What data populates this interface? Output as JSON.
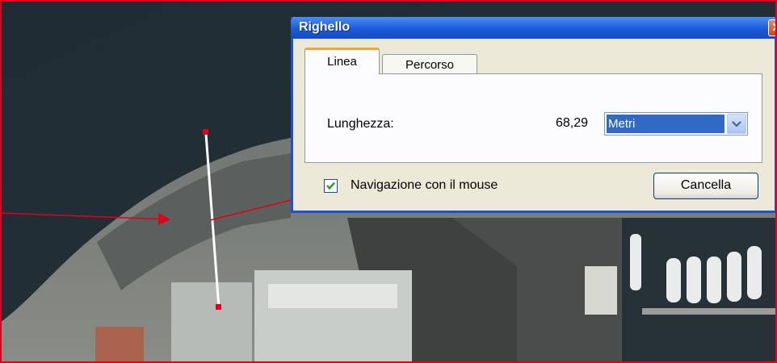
{
  "dialog": {
    "title": "Righello",
    "close_label": "x",
    "tabs": [
      {
        "label": "Linea",
        "selected": true
      },
      {
        "label": "Percorso",
        "selected": false
      }
    ],
    "length_label": "Lunghezza:",
    "length_value": "68,29",
    "unit_selected": "Metri",
    "mouse_nav_label": "Navigazione con il mouse",
    "mouse_nav_checked": true,
    "cancel_label": "Cancella"
  },
  "colors": {
    "annotation_red": "#e2001a",
    "titlebar_blue": "#1a5bd8",
    "selection_blue": "#316ac5"
  },
  "icons": [
    "close-icon",
    "chevron-down-icon",
    "checkmark-icon"
  ]
}
